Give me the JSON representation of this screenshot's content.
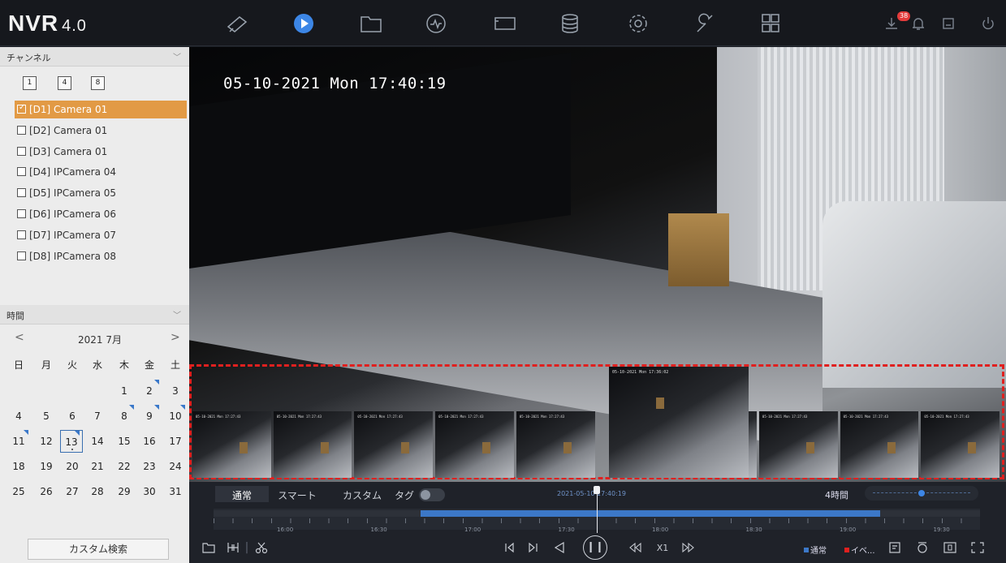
{
  "app": {
    "logo": "NVR",
    "version": "4.0"
  },
  "top_nav": [
    "live-view-icon",
    "playback-icon",
    "file-icon",
    "search-icon",
    "hdd-icon",
    "storage-icon",
    "settings-icon",
    "maintenance-icon",
    "apps-icon"
  ],
  "top_right": {
    "alarm_count": "38"
  },
  "channel_panel": {
    "header": "チャンネル",
    "window_buttons": [
      "1",
      "4",
      "8"
    ],
    "channels": [
      {
        "label": "[D1] Camera 01",
        "checked": true
      },
      {
        "label": "[D2] Camera 01",
        "checked": false
      },
      {
        "label": "[D3] Camera 01",
        "checked": false
      },
      {
        "label": "[D4] IPCamera 04",
        "checked": false
      },
      {
        "label": "[D5] IPCamera 05",
        "checked": false
      },
      {
        "label": "[D6] IPCamera 06",
        "checked": false
      },
      {
        "label": "[D7] IPCamera 07",
        "checked": false
      },
      {
        "label": "[D8] IPCamera 08",
        "checked": false
      }
    ]
  },
  "time_panel": {
    "header": "時間",
    "month_label": "2021 7月",
    "weekdays": [
      "日",
      "月",
      "火",
      "水",
      "木",
      "金",
      "土"
    ],
    "weeks": [
      [
        "",
        "",
        "",
        "",
        "1",
        "2",
        "3"
      ],
      [
        "4",
        "5",
        "6",
        "7",
        "8",
        "9",
        "10"
      ],
      [
        "11",
        "12",
        "13",
        "14",
        "15",
        "16",
        "17"
      ],
      [
        "18",
        "19",
        "20",
        "21",
        "22",
        "23",
        "24"
      ],
      [
        "25",
        "26",
        "27",
        "28",
        "29",
        "30",
        "31"
      ]
    ],
    "recorded_days": [
      "2",
      "8",
      "9",
      "10",
      "11",
      "13"
    ],
    "selected_day": "13",
    "custom_search": "カスタム検索"
  },
  "video": {
    "osd_time": "05-10-2021 Mon 17:40:19",
    "thumb_time": "05-10-2021 Mon 17:36:02",
    "thumb_small_time": "05-10-2021 Mon 17:27:43"
  },
  "playback": {
    "tabs": [
      "通常",
      "スマート",
      "カスタム",
      "タグ"
    ],
    "active_tab": "通常",
    "cursor_time": "2021-05-10 17:40:19",
    "zoom_label": "4時間",
    "tick_labels": [
      "16:00",
      "16:30",
      "17:00",
      "17:30",
      "18:00",
      "18:30",
      "19:00",
      "19:30"
    ],
    "speed": "X1",
    "legend_normal": "通常",
    "legend_event": "イベ...",
    "legend_normal_color": "#3c78c8",
    "legend_event_color": "#e0201f",
    "recorded_fraction": [
      0.27,
      0.87
    ],
    "playhead_fraction": 0.5
  }
}
